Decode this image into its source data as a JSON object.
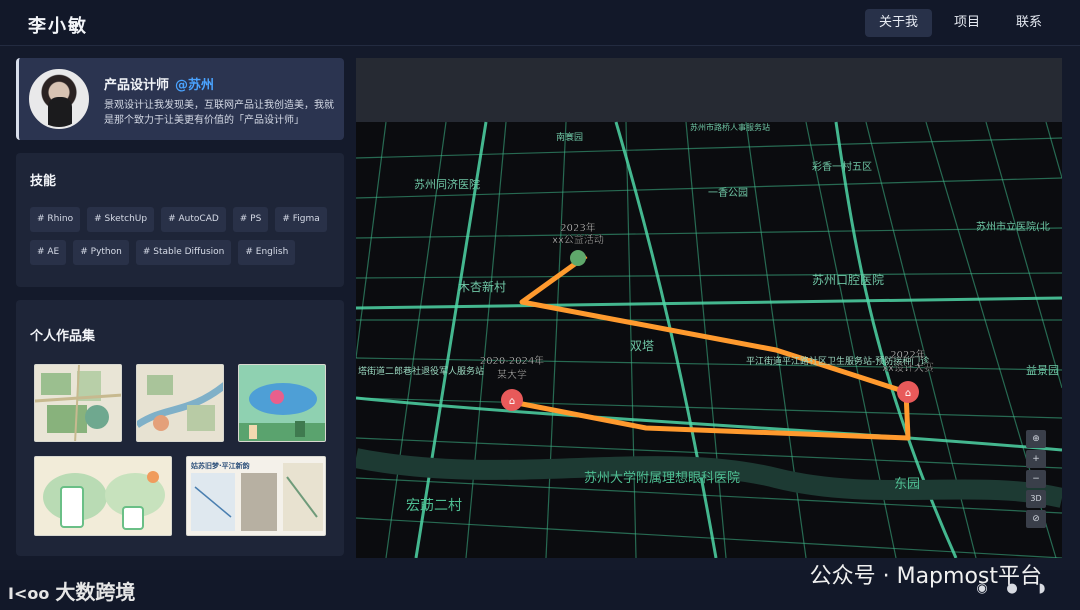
{
  "header": {
    "logo": "李小敏",
    "nav": [
      {
        "label": "关于我",
        "active": true
      },
      {
        "label": "项目",
        "active": false
      },
      {
        "label": "联系",
        "active": false
      }
    ]
  },
  "profile": {
    "title": "产品设计师",
    "city": "@苏州",
    "desc": "景观设计让我发现美，互联网产品让我创造美，我就是那个致力于让美更有价值的「产品设计师」"
  },
  "skills": {
    "title": "技能",
    "items": [
      "# Rhino",
      "# SketchUp",
      "# AutoCAD",
      "# PS",
      "# Figma",
      "# AE",
      "# Python",
      "# Stable Diffusion",
      "# English"
    ]
  },
  "works": {
    "title": "个人作品集",
    "thumb4_text": "姑苏旧梦·平江新韵"
  },
  "map": {
    "labels": [
      {
        "text": "苏州同济医院"
      },
      {
        "text": "木杏新村"
      },
      {
        "text": "双塔"
      },
      {
        "text": "苏州口腔医院"
      },
      {
        "text": "彩香一村五区"
      },
      {
        "text": "苏州市立医院(北"
      },
      {
        "text": "平江街道平江路社区卫生服务站-预防接种门诊"
      },
      {
        "text": "塔街道二郎巷社退役军人服务站"
      },
      {
        "text": "苏州大学附属理想眼科医院"
      },
      {
        "text": "宏莇二村"
      },
      {
        "text": "东园"
      },
      {
        "text": "益景园"
      },
      {
        "text": "一香公园"
      },
      {
        "text": "南寰园"
      },
      {
        "text": "苏州市路桥人事服务站"
      }
    ],
    "markers": [
      {
        "year": "2023年",
        "name": "xx公益活动"
      },
      {
        "year": "2020-2024年",
        "name": "某大学"
      },
      {
        "year": "2022年",
        "name": "xx设计大赛"
      }
    ],
    "controls": [
      "⊕",
      "+",
      "−",
      "3D",
      "⊘"
    ]
  },
  "footer": {
    "brand": "大数跨境",
    "brand_mark": "I<oo",
    "wechat": "公众号 · Mapmost平台",
    "icons": [
      "wechat-icon",
      "github-icon",
      "rss-icon"
    ]
  },
  "colors": {
    "background": "#141a2b",
    "accent": "#4aa3ff",
    "route": "#ff9a2e",
    "roads": "#4fd6a6"
  }
}
